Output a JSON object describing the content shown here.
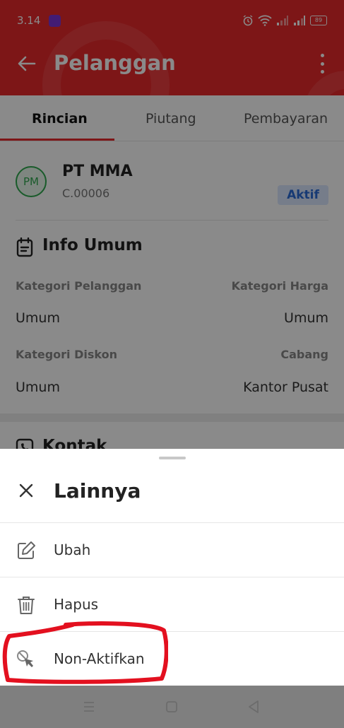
{
  "status_bar": {
    "time": "3.14",
    "battery": "89"
  },
  "app_bar": {
    "title": "Pelanggan",
    "back_icon": "arrow-left-icon",
    "more_icon": "more-vertical-icon"
  },
  "tabs": [
    {
      "label": "Rincian",
      "active": true
    },
    {
      "label": "Piutang",
      "active": false
    },
    {
      "label": "Pembayaran",
      "active": false
    }
  ],
  "customer": {
    "initials": "PM",
    "name": "PT MMA",
    "code": "C.00006",
    "status": "Aktif"
  },
  "info_umum": {
    "title": "Info Umum",
    "kategori_pelanggan_label": "Kategori Pelanggan",
    "kategori_pelanggan_value": "Umum",
    "kategori_harga_label": "Kategori Harga",
    "kategori_harga_value": "Umum",
    "kategori_diskon_label": "Kategori Diskon",
    "kategori_diskon_value": "Umum",
    "cabang_label": "Cabang",
    "cabang_value": "Kantor Pusat"
  },
  "kontak": {
    "title": "Kontak"
  },
  "sheet": {
    "title": "Lainnya",
    "items": [
      {
        "label": "Ubah",
        "icon": "edit-icon"
      },
      {
        "label": "Hapus",
        "icon": "trash-icon"
      },
      {
        "label": "Non-Aktifkan",
        "icon": "deactivate-icon"
      }
    ]
  },
  "colors": {
    "brand_red": "#e8292b",
    "status_badge_bg": "#dbe7ff",
    "status_badge_text": "#2b6cd6",
    "avatar_green": "#2fa84f",
    "annotation_red": "#e3101f"
  }
}
